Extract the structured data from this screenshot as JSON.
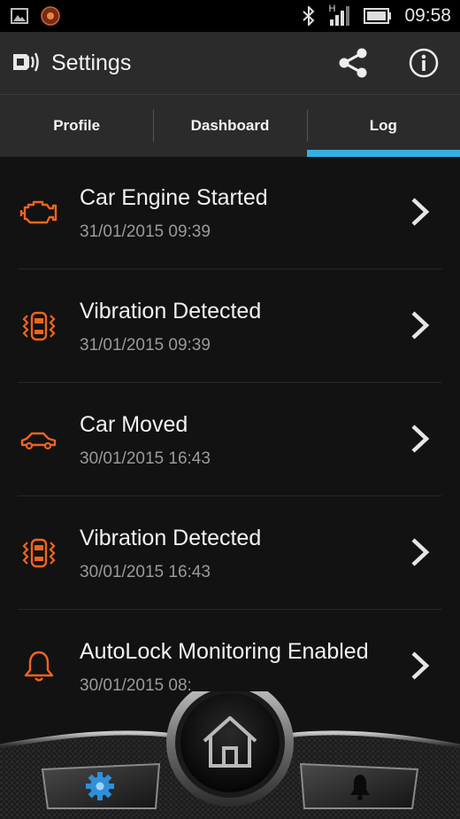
{
  "status_bar": {
    "time": "09:58",
    "signal_label": "H",
    "icons": [
      "gallery-icon",
      "app-notification-icon",
      "bluetooth-icon",
      "signal-icon",
      "battery-icon"
    ]
  },
  "action_bar": {
    "title": "Settings",
    "icons": [
      "app-logo-icon",
      "share-icon",
      "info-icon"
    ]
  },
  "tabs": [
    {
      "label": "Profile",
      "active": false
    },
    {
      "label": "Dashboard",
      "active": false
    },
    {
      "label": "Log",
      "active": true
    }
  ],
  "log_entries": [
    {
      "title": "Car Engine Started",
      "date": "31/01/2015 09:39",
      "icon": "engine-icon"
    },
    {
      "title": "Vibration Detected",
      "date": "31/01/2015 09:39",
      "icon": "vibration-icon"
    },
    {
      "title": "Car Moved",
      "date": "30/01/2015 16:43",
      "icon": "car-icon"
    },
    {
      "title": "Vibration Detected",
      "date": "30/01/2015 16:43",
      "icon": "vibration-icon"
    },
    {
      "title": "AutoLock Monitoring Enabled",
      "date": "30/01/2015 08:",
      "icon": "bell-icon"
    }
  ],
  "bottom_dock": {
    "buttons": [
      "settings-gear-icon",
      "home-icon",
      "notifications-bell-icon"
    ]
  },
  "colors": {
    "accent_blue": "#35aee2",
    "icon_orange": "#f2641d",
    "background": "#121212",
    "bar_background": "#2b2b2b"
  }
}
